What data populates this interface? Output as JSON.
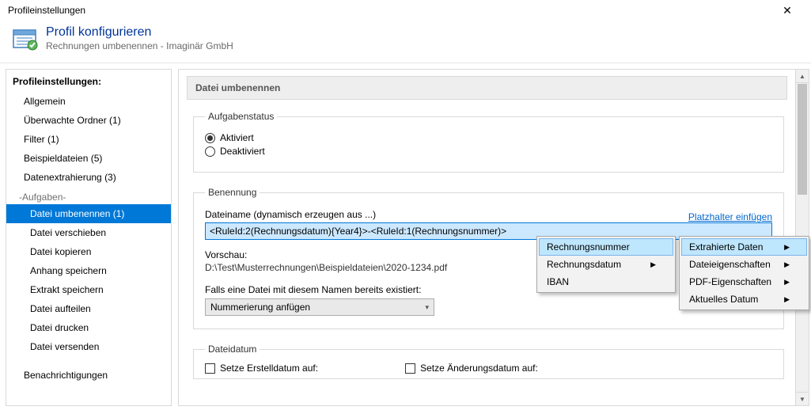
{
  "window": {
    "title": "Profileinstellungen"
  },
  "header": {
    "title": "Profil konfigurieren",
    "subtitle": "Rechnungen umbenennen - Imaginär GmbH"
  },
  "sidebar": {
    "title": "Profileinstellungen:",
    "items": [
      "Allgemein",
      "Überwachte Ordner (1)",
      "Filter (1)",
      "Beispieldateien (5)",
      "Datenextrahierung (3)"
    ],
    "tasks_label": "-Aufgaben-",
    "tasks": [
      "Datei umbenennen (1)",
      "Datei verschieben",
      "Datei kopieren",
      "Anhang speichern",
      "Extrakt speichern",
      "Datei aufteilen",
      "Datei drucken",
      "Datei versenden"
    ],
    "footer": "Benachrichtigungen"
  },
  "main": {
    "section_title": "Datei umbenennen",
    "status_group": "Aufgabenstatus",
    "radio_on": "Aktiviert",
    "radio_off": "Deaktiviert",
    "naming_group": "Benennung",
    "filename_label": "Dateiname (dynamisch erzeugen aus ...)",
    "insert_link": "Platzhalter einfügen",
    "filename_value": "<RuleId:2(Rechnungsdatum){Year4}>-<RuleId:1(Rechnungsnummer)>",
    "preview_label": "Vorschau:",
    "preview_path": "D:\\Test\\Musterrechnungen\\Beispieldateien\\2020-1234.pdf",
    "exists_label": "Falls eine Datei mit diesem Namen bereits existiert:",
    "exists_value": "Nummerierung anfügen",
    "filedate_group": "Dateidatum",
    "cb_created": "Setze Erstelldatum auf:",
    "cb_modified": "Setze Änderungsdatum auf:"
  },
  "menu_left": {
    "items": [
      "Rechnungsnummer",
      "Rechnungsdatum",
      "IBAN"
    ]
  },
  "menu_right": {
    "items": [
      "Extrahierte Daten",
      "Dateieigenschaften",
      "PDF-Eigenschaften",
      "Aktuelles Datum"
    ]
  }
}
